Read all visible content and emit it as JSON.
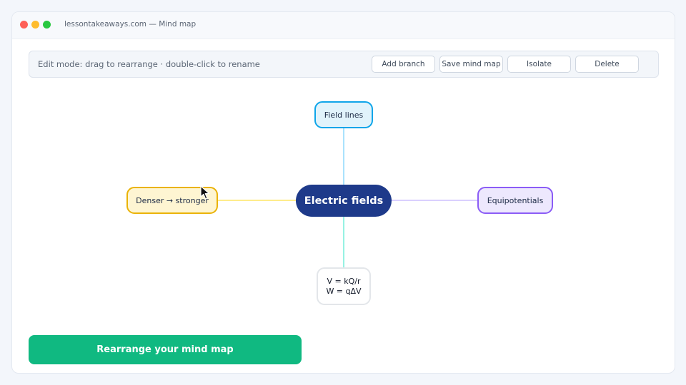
{
  "window": {
    "title": "lessontakeaways.com — Mind map"
  },
  "toolbar": {
    "hint": "Edit mode: drag to rearrange · double-click to rename",
    "buttons": [
      "Add branch",
      "Save mind map",
      "Isolate",
      "Delete"
    ]
  },
  "mindmap": {
    "center": "Electric fields",
    "branches": {
      "top": "Field lines",
      "left": "Denser → stronger",
      "right": "Equipotentials",
      "bottom_line1": "V = kQ/r",
      "bottom_line2": "W = qΔV"
    },
    "colors": {
      "center": "#1e3a8a",
      "top": "#0ea5e9",
      "left": "#eab308",
      "right": "#8b5cf6",
      "bottom": "#2dd4bf"
    }
  },
  "cta": {
    "label": "Rearrange your mind map",
    "color": "#10b981"
  },
  "icons": [
    "mouse-pointer-icon"
  ]
}
